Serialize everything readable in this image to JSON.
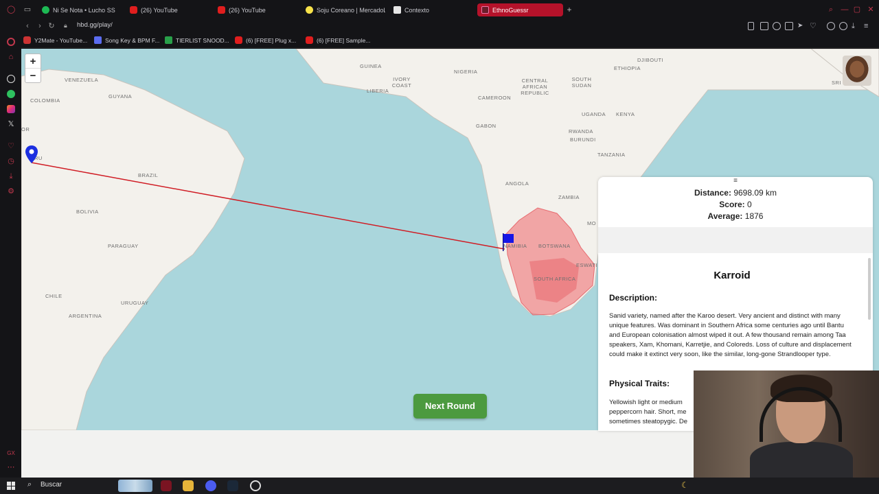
{
  "browser": {
    "tabs": [
      {
        "label": "Ni Se Nota • Lucho SS",
        "icon": "spotify-icon",
        "active": false
      },
      {
        "label": "(26) YouTube",
        "icon": "youtube-icon",
        "active": false
      },
      {
        "label": "(26) YouTube",
        "icon": "youtube-icon",
        "active": false
      },
      {
        "label": "Soju Coreano | MercadoL",
        "icon": "mercadolibre-icon",
        "active": false
      },
      {
        "label": "Contexto",
        "icon": "contexto-icon",
        "active": false
      },
      {
        "label": "EthnoGuessr",
        "icon": "ethnoguessr-icon",
        "active": true
      }
    ],
    "url": "hbd.gg/play/",
    "bookmarks": [
      {
        "label": "Y2Mate - YouTube..."
      },
      {
        "label": "Song Key & BPM F..."
      },
      {
        "label": "TIERLIST SNOOD..."
      },
      {
        "label": "(6) [FREE] Plug x..."
      },
      {
        "label": "(6) [FREE] Sample..."
      }
    ]
  },
  "map": {
    "zoom_in": "+",
    "zoom_out": "−",
    "labels": {
      "venezuela": "VENEZUELA",
      "colombia": "COLOMBIA",
      "guyana": "GUYANA",
      "peru": "RU",
      "brazil": "BRAZIL",
      "bolivia": "BOLIVIA",
      "paraguay": "PARAGUAY",
      "chile": "CHILE",
      "uruguay": "URUGUAY",
      "argentina": "ARGENTINA",
      "guinea": "GUINEA",
      "ivory_coast": "IVORY COAST",
      "liberia": "LIBERIA",
      "nigeria": "NIGERIA",
      "cameroon": "CAMEROON",
      "car": "CENTRAL AFRICAN REPUBLIC",
      "gabon": "GABON",
      "ethiopia": "ETHIOPIA",
      "djibouti": "DJIBOUTI",
      "south_sudan": "SOUTH SUDAN",
      "uganda": "UGANDA",
      "kenya": "KENYA",
      "rwanda": "RWANDA",
      "burundi": "BURUNDI",
      "tanzania": "TANZANIA",
      "angola": "ANGOLA",
      "zambia": "ZAMBIA",
      "namibia": "NAMIBIA",
      "botswana": "BOTSWANA",
      "south_africa": "SOUTH AFRICA",
      "eswatini": "ESWATI",
      "mozambique": "MO",
      "sri": "SRI",
      "or": "OR"
    },
    "guess_marker_icon": "map-pin-icon",
    "answer_marker_icon": "flag-icon",
    "line_color": "#d01c24",
    "region_color": "#f07c80"
  },
  "result": {
    "distance_label": "Distance:",
    "distance_value": "9698.09 km",
    "score_label": "Score:",
    "score_value": "0",
    "average_label": "Average:",
    "average_value": "1876",
    "handle_icon": "≡",
    "type_title": "Karroid",
    "description_heading": "Description:",
    "description": "Sanid variety, named after the Karoo desert. Very ancient and distinct with many unique features. Was dominant in Southern Africa some centuries ago until Bantu and European colonisation almost wiped it out. A few thousand remain among Taa speakers, Xam, Khomani, Karretjie, and Coloreds. Loss of culture and displacement could make it extinct very soon, like the similar, long-gone Strandlooper type.",
    "traits_heading": "Physical Traits:",
    "traits": "Yellowish light or medium peppercorn hair. Short, me sometimes steatopygic. De"
  },
  "next_round_label": "Next Round",
  "taskbar": {
    "search_label": "Buscar"
  }
}
